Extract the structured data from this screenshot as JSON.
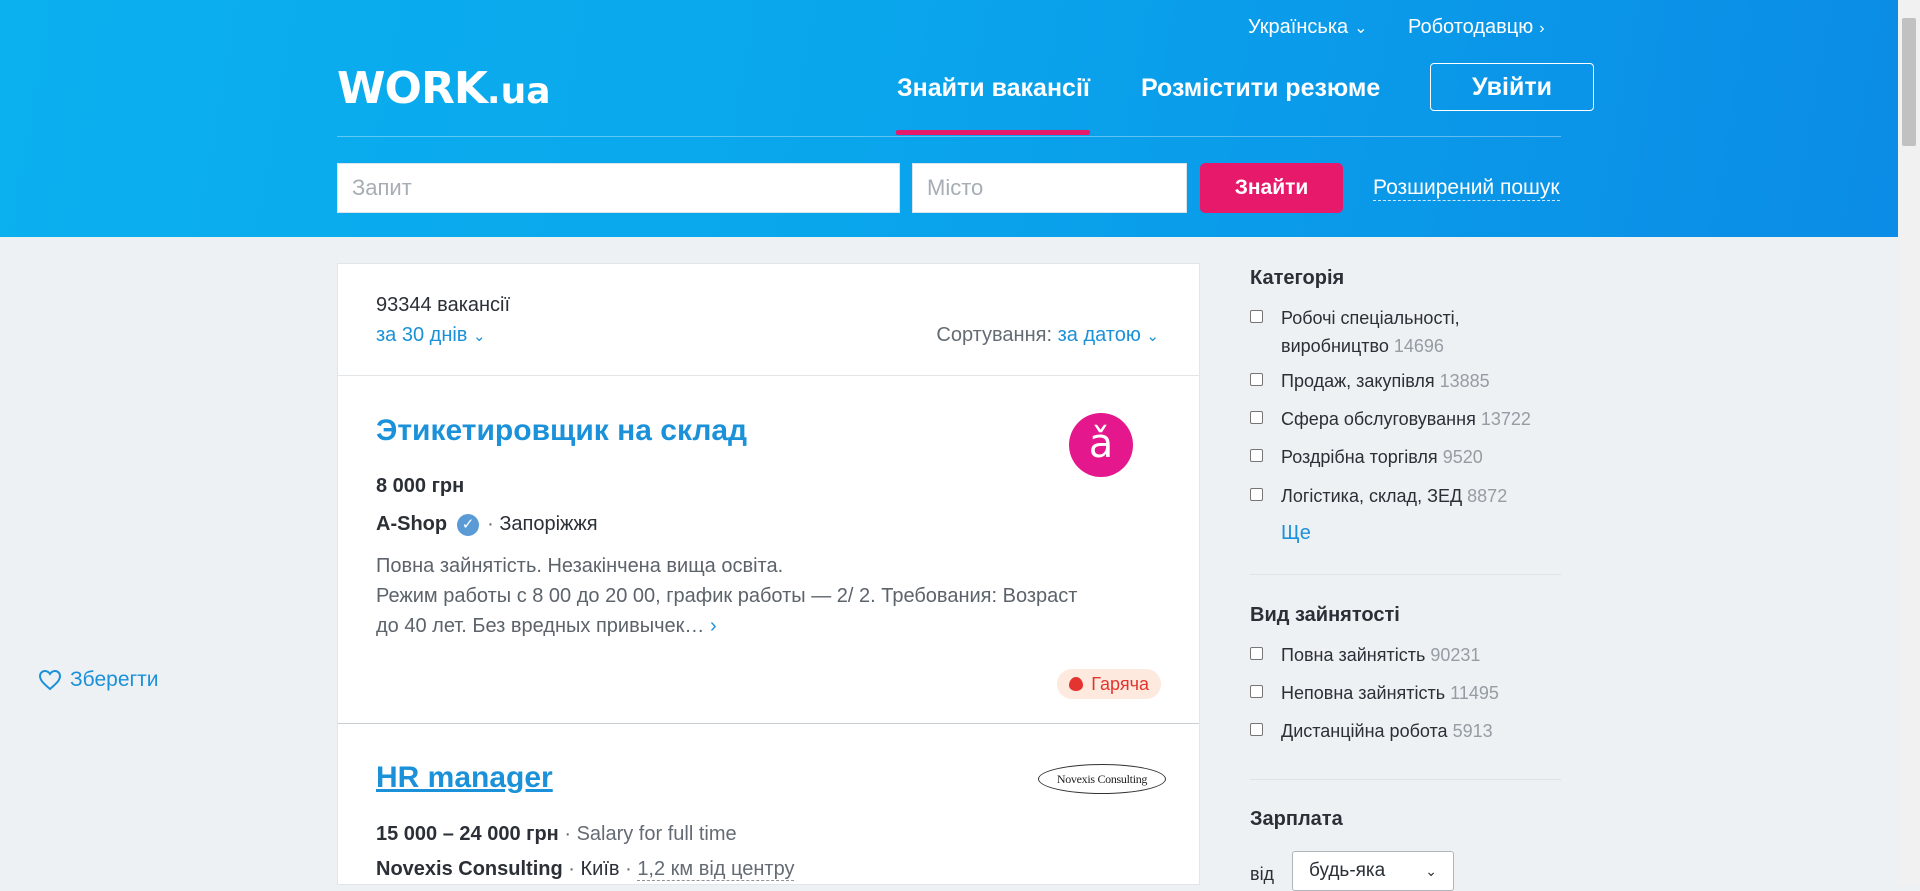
{
  "header": {
    "lang": "Українська",
    "employer": "Роботодавцю",
    "logo_main": "WORK",
    "logo_suffix": ".ua",
    "nav_find": "Знайти вакансії",
    "nav_resume": "Розмістити резюме",
    "login": "Увійти",
    "query_placeholder": "Запит",
    "city_placeholder": "Місто",
    "search": "Знайти",
    "advanced": "Розширений пошук"
  },
  "results": {
    "count": "93344 вакансії",
    "period": "за 30 днів",
    "sort_label": "Сортування:",
    "sort_value": "за датою"
  },
  "jobs": [
    {
      "title": "Этикетировщик на склад",
      "salary": "8 000 грн",
      "company": "A-Shop",
      "city": "Запоріжжя",
      "desc_line1": "Повна зайнятість. Незакінчена вища освіта.",
      "desc_line2": "Режим работы с 8 00 до 20 00, график работы — 2/ 2. Требования: Возраст",
      "desc_line3": "до 40 лет. Без вредных привычек…",
      "save": "Зберегти",
      "badge": "Гаряча",
      "logo_text": "ǎ"
    },
    {
      "title": "HR manager",
      "salary": "15 000 – 24 000 грн",
      "salary_note": "Salary for full time",
      "company": "Novexis Consulting",
      "city": "Київ",
      "distance": "1,2 км від центру",
      "logo_text": "Novexis Consulting"
    }
  ],
  "sidebar": {
    "category_title": "Категорія",
    "categories": [
      {
        "label": "Робочі спеціальності, виробництво",
        "label_l1": "Робочі спеціальності,",
        "label_l2": "виробництво",
        "count": "14696"
      },
      {
        "label": "Продаж, закупівля",
        "count": "13885"
      },
      {
        "label": "Сфера обслуговування",
        "count": "13722"
      },
      {
        "label": "Роздрібна торгівля",
        "count": "9520"
      },
      {
        "label": "Логістика, склад, ЗЕД",
        "count": "8872"
      }
    ],
    "more": "Ще",
    "employment_title": "Вид зайнятості",
    "employment": [
      {
        "label": "Повна зайнятість",
        "count": "90231"
      },
      {
        "label": "Неповна зайнятість",
        "count": "11495"
      },
      {
        "label": "Дистанційна робота",
        "count": "5913"
      }
    ],
    "salary_title": "Зарплата",
    "salary_from": "від",
    "salary_value": "будь-яка"
  },
  "colors": {
    "header_blue": "#0aa6ec",
    "accent_pink": "#e6196b",
    "link_blue": "#1a91d8"
  }
}
